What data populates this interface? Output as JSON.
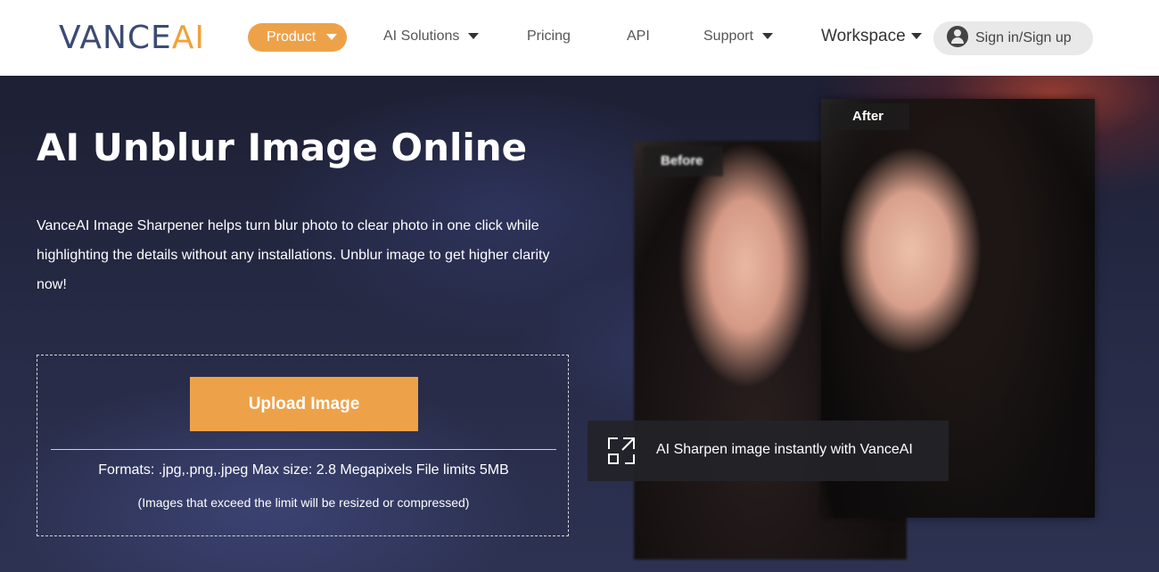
{
  "logo": {
    "brand": "VANCE",
    "ai": "AI"
  },
  "nav": {
    "product": "Product",
    "ai_solutions": "AI Solutions",
    "pricing": "Pricing",
    "api": "API",
    "support": "Support",
    "workspace": "Workspace",
    "signin": "Sign in/Sign up"
  },
  "hero": {
    "title": "AI Unblur Image Online",
    "description": "VanceAI Image Sharpener helps turn blur photo to clear photo in one click while highlighting the details without any installations. Unblur image to get higher clarity now!",
    "upload_button": "Upload Image",
    "formats": "Formats: .jpg,.png,.jpeg Max size: 2.8 Megapixels File limits 5MB",
    "resize_note": "(Images that exceed the limit will be resized or compressed)"
  },
  "comparison": {
    "before_label": "Before",
    "after_label": "After",
    "caption": "AI Sharpen image instantly with VanceAI"
  },
  "colors": {
    "accent": "#eda24a",
    "logo_blue": "#3c4a73"
  },
  "icons": {
    "expand": "expand-icon",
    "user": "user-icon",
    "dropdown": "chevron-down-icon"
  }
}
